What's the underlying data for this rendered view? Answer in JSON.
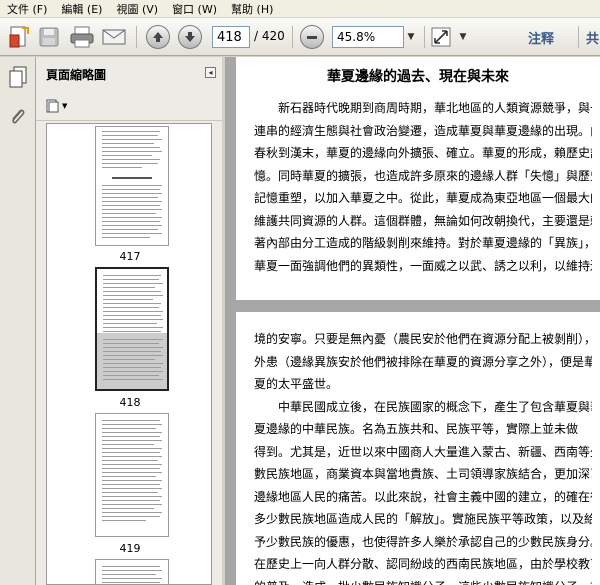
{
  "menu": {
    "items": [
      "文件 (F)",
      "編輯 (E)",
      "視圖 (V)",
      "窗口 (W)",
      "幫助 (H)"
    ]
  },
  "toolbar": {
    "current_page": "418",
    "total_pages": "/ 420",
    "zoom": "45.8%",
    "annotate_label": "注释",
    "share_label": "共"
  },
  "panel": {
    "title": "頁面縮略圖"
  },
  "thumbnails": [
    {
      "label": "417",
      "selected": false
    },
    {
      "label": "418",
      "selected": true
    },
    {
      "label": "419",
      "selected": false
    }
  ],
  "page1": {
    "title": "華夏邊緣的過去、現在與未來",
    "lines": [
      "新石器時代晚期到商周時期，華北地區的人類資源競爭，與一",
      "連串的經濟生態與社會政治變遷，造成華夏與華夏邊緣的出現。由",
      "春秋到漢末，華夏的邊緣向外擴張、確立。華夏的形成，賴歷史記",
      "憶。同時華夏的擴張，也造成許多原來的邊緣人群「失憶」與歷史",
      "記憶重塑，以加入華夏之中。從此，華夏成為東亞地區一個最大的",
      "維護共同資源的人群。這個群體，無論如何改朝換代，主要還是賴",
      "著內部由分工造成的階級剝削來維持。對於華夏邊緣的「異族」，",
      "華夏一面強調他們的異類性，一面威之以武、誘之以利，以維持邊"
    ]
  },
  "page2": {
    "lines": [
      "境的安寧。只要是無內憂（農民安於他們在資源分配上被剝削），",
      "外患（邊緣異族安於他們被排除在華夏的資源分享之外），便是華",
      "夏的太平盛世。",
      "中華民國成立後，在民族國家的概念下，產生了包含華夏與華",
      "夏邊緣的中華民族。名為五族共和、民族平等，實際上並未做",
      "得到。尤其是，近世以來中國商人大量進入蒙古、新疆、西南等少",
      "數民族地區，商業資本與當地貴族、土司領導家族結合，更加深了",
      "邊緣地區人民的痛苦。以此來說，社會主義中國的建立，的確在很",
      "多少數民族地區造成人民的「解放」。實施民族平等政策，以及給",
      "予少數民族的優惠，也使得許多人樂於承認自己的少數民族身分。",
      "在歷史上一向人群分散、認同紛歧的西南民族地區，由於學校教育",
      "的普及，造成一批少數民族知識分子，這些少數民族知識分子，在"
    ]
  },
  "thumb_texts": {
    "page417_title": "華夏邊緣的過去、現在與未來"
  }
}
